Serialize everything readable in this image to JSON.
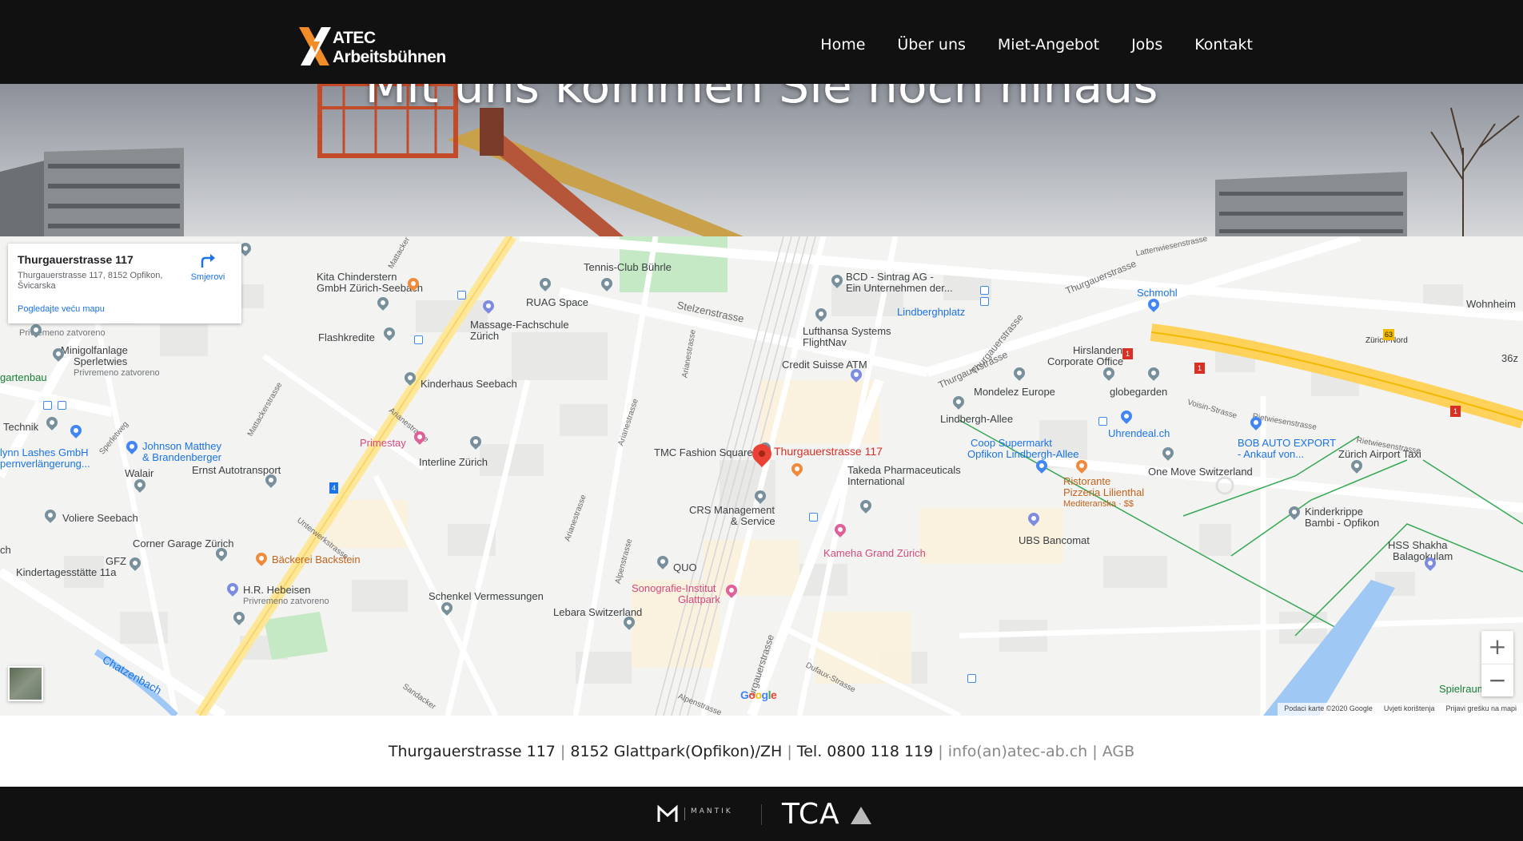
{
  "header": {
    "logo_text": "ATEC Arbeitsbühnen",
    "nav": [
      {
        "label": "Home"
      },
      {
        "label": "Über uns"
      },
      {
        "label": "Miet-Angebot"
      },
      {
        "label": "Jobs"
      },
      {
        "label": "Kontakt"
      }
    ]
  },
  "hero": {
    "title": "Mit uns kommen Sie noch hinaus"
  },
  "map": {
    "card": {
      "title": "Thurgauerstrasse 117",
      "address": "Thurgauerstrasse 117, 8152 Opfikon, Švicarska",
      "directions": "Smjerovi",
      "larger_map": "Pogledajte veću mapu"
    },
    "marker_label": "Thurgauerstrasse 117",
    "google": "Google",
    "attribution": [
      "Podaci karte ©2020 Google",
      "Uvjeti korištenja",
      "Prijavi grešku na mapi"
    ],
    "zoom_in": "+",
    "zoom_out": "−",
    "labels": {
      "tennis": "Tennis-Club Bührle",
      "kita": "Kita Chinderstern",
      "kita2": "GmbH Zürich-Seebach",
      "ruag": "RUAG Space",
      "massage": "Massage-Fachschule",
      "massage2": "Zürich",
      "flash": "Flashkredite",
      "bcd": "BCD - Sintrag AG -",
      "bcd2": "Ein Unternehmen der...",
      "lindbergh": "Lindberghplatz",
      "lufthansa": "Lufthansa Systems",
      "lufthansa2": "FlightNav",
      "credit": "Credit Suisse ATM",
      "schmohl": "Schmohl",
      "wohnheim": "Wohnheim",
      "hirslanden": "Hirslanden",
      "hirslanden2": "Corporate Office",
      "mondelez": "Mondelez Europe",
      "globe": "globegarden",
      "lindallee": "Lindbergh-Allee",
      "uhren": "Uhrendeal.ch",
      "bob": "BOB AUTO EXPORT",
      "bob2": "- Ankauf von...",
      "airport": "Zürich Airport Taxi",
      "onemove": "One Move Switzerland",
      "coop": "Coop Supermarkt",
      "coop2": "Opfikon Lindbergh-Allee",
      "ristorante": "Ristorante",
      "ristorante2": "Pizzeria Lilienthal",
      "ristorante3": "Mediteranska · $$",
      "takeda": "Takeda Pharmaceuticals",
      "takeda2": "International",
      "tmc": "TMC Fashion Square",
      "crs": "CRS Management",
      "crs2": "& Service",
      "kinderhaus": "Kinderhaus Seebach",
      "primestay": "Primestay",
      "interline": "Interline Zürich",
      "johnson": "Johnson Matthey",
      "johnson2": "& Brandenberger",
      "ernst": "Ernst Autotransport",
      "walair": "Walair",
      "voliere": "Voliere Seebach",
      "corner": "Corner Garage Zürich",
      "gfz": "GFZ",
      "kinder11": "Kindertagesstätte 11a",
      "baeckerei": "Bäckerei Backstein",
      "hebeisen": "H.R. Hebeisen",
      "hebeisen2": "Privremeno zatvoreno",
      "schenkel": "Schenkel Vermessungen",
      "lebara": "Lebara Switzerland",
      "quo": "QUO",
      "sono": "Sonografie-Institut",
      "sono2": "Glattpark",
      "kameha": "Kameha Grand Zürich",
      "ubs": "UBS Bancomat",
      "krippe": "Kinderkrippe",
      "krippe2": "Bambi - Opfikon",
      "hss": "HSS Shakha",
      "hss2": "Balagokulam",
      "spielraum": "Spielraum Gl",
      "mini": "Minigolfanlage",
      "mini2": "Sperletwies",
      "mini3": "Privremeno zatvoreno",
      "privremeno": "Privremeno zatvoreno",
      "garten": "gartenbau",
      "technik": "Technik",
      "lynn": "lynn Lashes GmbH",
      "lynn2": "pernverlängerung...",
      "chatzenbach": "Chatzenbach",
      "zuerichnord": "Zürich-Nord",
      "s36": "36z",
      "sch": "ch",
      "st_stelzen": "Stelzenstrasse",
      "st_thurgauer": "Thurgauerstrasse",
      "st_thurgauer2": "Thurgauerstrasse",
      "st_thurgauer3": "Thurgauerstrasse",
      "st_thurgauer4": "urgauerstrasse",
      "st_lattenwiesen": "Lattenwiesenstrasse",
      "st_voisin": "Voisin-Strasse",
      "st_riet": "Rietwiesenstrasse",
      "st_riet2": "Rietwiesenstrasse",
      "st_arianestr": "Arianestrasse",
      "st_arianestr2": "Arianestrasse",
      "st_arianestr3": "Arianestrasse",
      "st_arianestr4": "Arianestrasse",
      "st_matt": "Mattackerstrasse",
      "st_matt2": "Mattacker",
      "st_sperlet": "Sperletweg",
      "st_unterwerk": "Unterwerkstrasse",
      "st_alpen": "Alpenstrasse",
      "st_alpen2": "Alpenstrasse",
      "st_sandacker": "Sandacker",
      "st_dufaux": "Dufaux-Strasse",
      "r63": "63",
      "r1a": "1",
      "r1b": "1",
      "r1c": "1",
      "r4": "4"
    }
  },
  "contact": {
    "street": "Thurgauerstrasse 117",
    "city": "8152 Glattpark(Opfikon)/ZH",
    "phone": "Tel. 0800 118 119",
    "email": "info(an)atec-ab.ch",
    "agb": "AGB"
  },
  "footer": {
    "brand1": "MANTIK",
    "brand2": "TCA"
  },
  "colors": {
    "header_bg": "#111111",
    "logo_orange": "#f28c28",
    "map_bg": "#f3f3f1",
    "accent_blue": "#1a73e8",
    "marker_red": "#ea4335"
  }
}
